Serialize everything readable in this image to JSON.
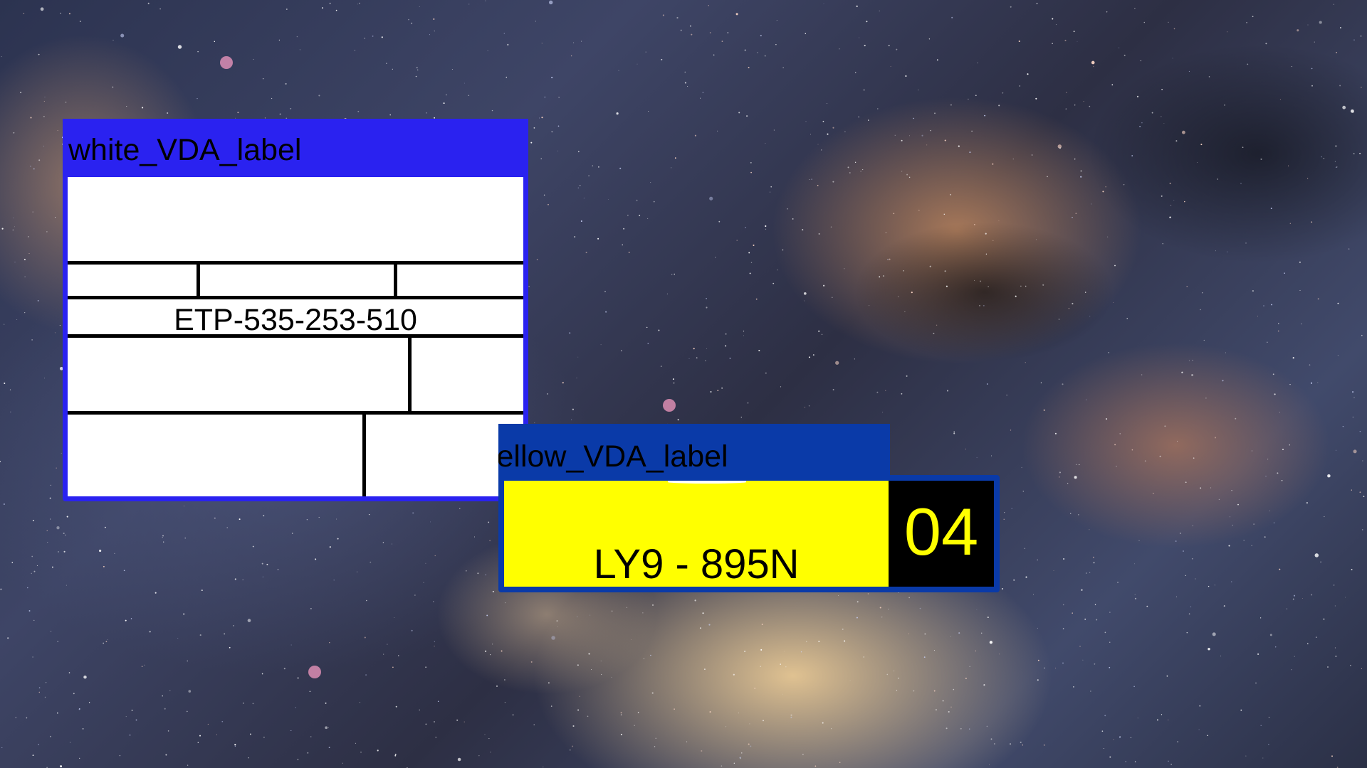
{
  "desktop": {
    "wallpaper": "milky-way-starfield"
  },
  "white_window": {
    "title": "white_VDA_label",
    "title_bar_color": "#2a22f0",
    "id_text": "ETP-535-253-510"
  },
  "yellow_window": {
    "title": "yellow_VDA_label",
    "title_bar_color": "#0a3aa8",
    "plate_text": "LY9 - 895N",
    "plate_color": "#ffff00",
    "code": "04",
    "code_color": "#ffff00"
  }
}
